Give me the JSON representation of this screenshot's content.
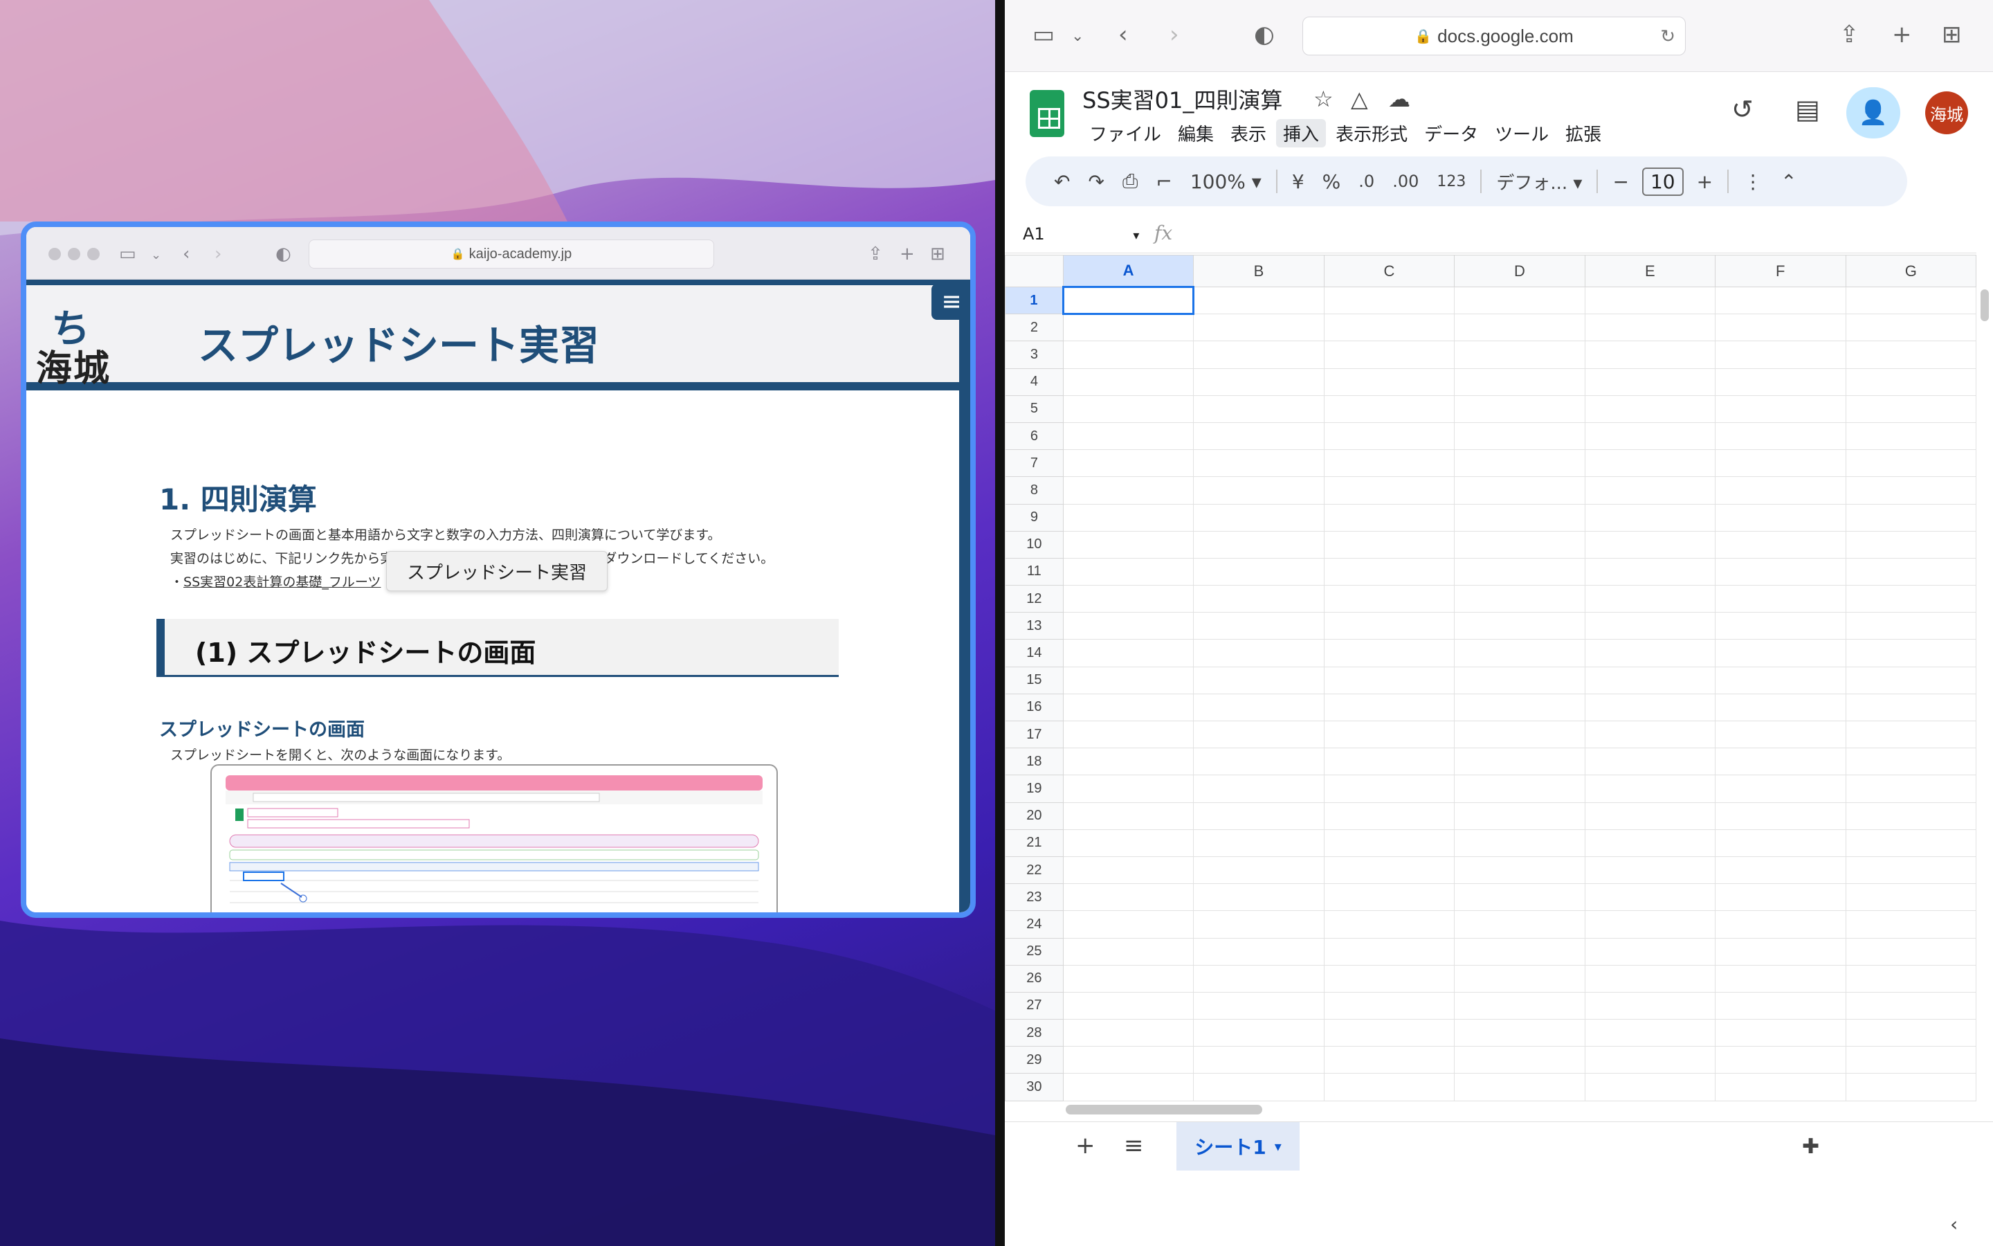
{
  "left_browser": {
    "url": "kaijo-academy.jp",
    "site": {
      "logo_text": "海城",
      "title": "スプレッドシート実習",
      "menu_icon": "hamburger-menu-icon"
    },
    "section_heading": "1. 四則演算",
    "paragraph_1": "スプレッドシートの画面と基本用語から文字と数字の入力方法、四則演算について学びます。",
    "paragraph_2": "実習のはじめに、下記リンク先から実習ファイルを各自の個別フォルダにダウンロードしてください。",
    "link_prefix": "・",
    "link_text": "SS実習02表計算の基礎_フルーツ",
    "tooltip": "スプレッドシート実習",
    "subsection_heading": "(1) スプレッドシートの画面",
    "sub_heading": "スプレッドシートの画面",
    "sub_paragraph": "スプレッドシートを開くと、次のような画面になります。"
  },
  "right_browser": {
    "url": "docs.google.com",
    "doc_title": "SS実習01_四則演算",
    "menu": [
      "ファイル",
      "編集",
      "表示",
      "挿入",
      "表示形式",
      "データ",
      "ツール",
      "拡張"
    ],
    "active_menu": "挿入",
    "avatar": "海城",
    "toolbar": {
      "zoom": "100%",
      "currency": "¥",
      "percent": "%",
      "dec_decrease": ".0",
      "dec_increase": ".00",
      "number_format": "123",
      "font": "デフォ...",
      "font_size": "10"
    },
    "name_box": "A1",
    "fx": "fx",
    "columns": [
      "A",
      "B",
      "C",
      "D",
      "E",
      "F",
      "G"
    ],
    "rows": [
      "1",
      "2",
      "3",
      "4",
      "5",
      "6",
      "7",
      "8",
      "9",
      "10",
      "11",
      "12",
      "13",
      "14",
      "15",
      "16",
      "17",
      "18",
      "19",
      "20",
      "21",
      "22",
      "23",
      "24",
      "25",
      "26",
      "27",
      "28",
      "29",
      "30"
    ],
    "active_cell": "A1",
    "sheet_tab": "シート1"
  }
}
